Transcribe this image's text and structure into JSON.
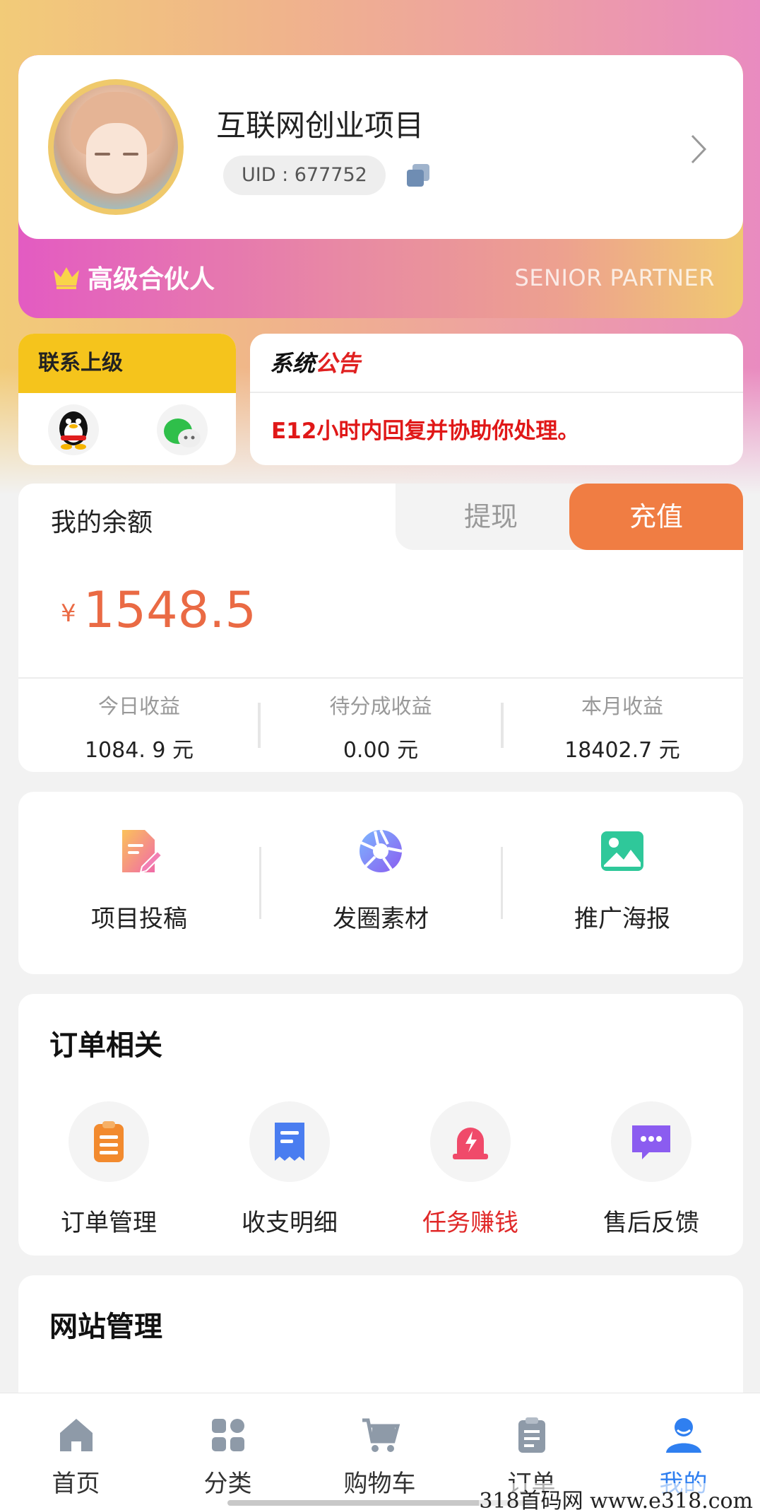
{
  "profile": {
    "nickname": "互联网创业项目",
    "uid": "UID : 677752",
    "level": "高级合伙人",
    "level_en": "SENIOR PARTNER"
  },
  "contact": {
    "title": "联系上级"
  },
  "notice": {
    "title_a": "系统",
    "title_b": "公告",
    "text": "E12小时内回复并协助你处理。"
  },
  "balance": {
    "label": "我的余额",
    "withdraw": "提现",
    "recharge": "充值",
    "currency": "¥",
    "amount": "1548.5",
    "stats": [
      {
        "label": "今日收益",
        "value": "1084. 9 元"
      },
      {
        "label": "待分成收益",
        "value": "0.00 元"
      },
      {
        "label": "本月收益",
        "value": "18402.7 元"
      }
    ]
  },
  "tools": [
    {
      "label": "项目投稿",
      "icon": "document-edit-icon"
    },
    {
      "label": "发圈素材",
      "icon": "aperture-icon"
    },
    {
      "label": "推广海报",
      "icon": "image-icon"
    }
  ],
  "orders": {
    "title": "订单相关",
    "items": [
      {
        "label": "订单管理",
        "icon": "clipboard-icon"
      },
      {
        "label": "收支明细",
        "icon": "receipt-icon"
      },
      {
        "label": "任务赚钱",
        "icon": "alarm-lightning-icon"
      },
      {
        "label": "售后反馈",
        "icon": "chat-bubble-icon"
      }
    ]
  },
  "site": {
    "title": "网站管理"
  },
  "tabbar": [
    {
      "label": "首页",
      "icon": "home-icon"
    },
    {
      "label": "分类",
      "icon": "grid-icon"
    },
    {
      "label": "购物车",
      "icon": "cart-icon"
    },
    {
      "label": "订单",
      "icon": "clipboard-icon"
    },
    {
      "label": "我的",
      "icon": "user-icon",
      "active": true
    }
  ],
  "colors": {
    "accent_orange": "#f07d43",
    "amount_orange": "#ea6a44",
    "active_blue": "#2f7ff0",
    "notice_red": "#e01818",
    "contact_yellow": "#f5c41c"
  },
  "watermark": "318首码网  www.e318.com"
}
